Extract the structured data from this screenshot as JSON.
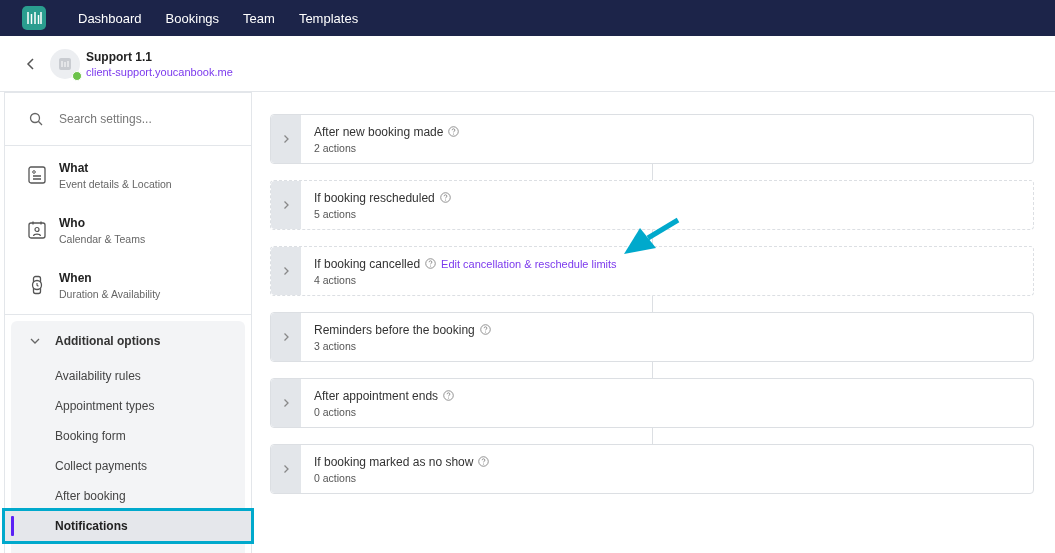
{
  "nav": {
    "items": [
      {
        "label": "Dashboard"
      },
      {
        "label": "Bookings"
      },
      {
        "label": "Team"
      },
      {
        "label": "Templates"
      }
    ]
  },
  "header": {
    "title": "Support 1.1",
    "link": "client-support.youcanbook.me",
    "online": true
  },
  "sidebar": {
    "search": {
      "placeholder": "Search settings..."
    },
    "sections": [
      {
        "kind": "card",
        "title": "What",
        "subtitle": "Event details & Location"
      },
      {
        "kind": "calendar",
        "title": "Who",
        "subtitle": "Calendar & Teams"
      },
      {
        "kind": "watch",
        "title": "When",
        "subtitle": "Duration & Availability"
      }
    ],
    "group": {
      "title": "Additional options",
      "expanded": true,
      "items": [
        {
          "label": "Availability rules",
          "selected": false,
          "highlighted": false
        },
        {
          "label": "Appointment types",
          "selected": false,
          "highlighted": false
        },
        {
          "label": "Booking form",
          "selected": false,
          "highlighted": false
        },
        {
          "label": "Collect payments",
          "selected": false,
          "highlighted": false
        },
        {
          "label": "After booking",
          "selected": false,
          "highlighted": false
        },
        {
          "label": "Notifications",
          "selected": true,
          "highlighted": true
        }
      ]
    }
  },
  "triggers": [
    {
      "kind": "solid",
      "title": "After new booking made",
      "count": "2 actions",
      "pointer": false
    },
    {
      "kind": "dashed",
      "title": "If booking rescheduled",
      "count": "5 actions",
      "pointer": false
    },
    {
      "kind": "dashed",
      "title": "If booking cancelled",
      "link": "Edit cancellation & reschedule limits",
      "count": "4 actions",
      "pointer": true
    },
    {
      "kind": "solid",
      "title": "Reminders before the booking",
      "count": "3 actions",
      "pointer": false
    },
    {
      "kind": "solid",
      "title": "After appointment ends",
      "count": "0 actions",
      "pointer": false
    },
    {
      "kind": "solid",
      "title": "If booking marked as no show",
      "count": "0 actions",
      "pointer": false
    }
  ]
}
